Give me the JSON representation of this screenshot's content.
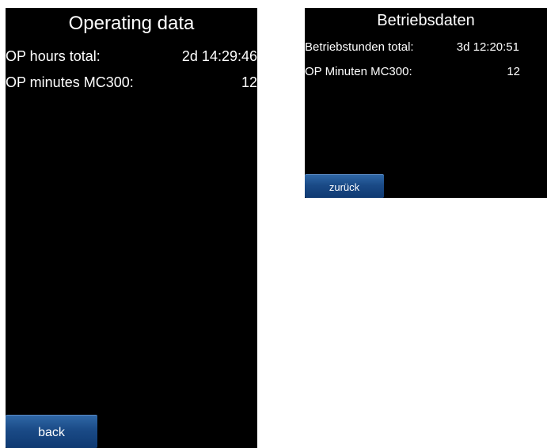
{
  "screen_en": {
    "title": "Operating data",
    "rows": [
      {
        "label": "OP hours total:",
        "value": "2d 14:29:46"
      },
      {
        "label": "OP minutes MC300:",
        "value": "12"
      }
    ],
    "back_label": "back"
  },
  "screen_de": {
    "title": "Betriebsdaten",
    "rows": [
      {
        "label": "Betriebstunden total:",
        "value": "3d 12:20:51"
      },
      {
        "label": "OP Minuten MC300:",
        "value": "12"
      }
    ],
    "back_label": "zurück"
  },
  "colors": {
    "screen_bg": "#000000",
    "text": "#ffffff",
    "button": "#1a4a86"
  }
}
